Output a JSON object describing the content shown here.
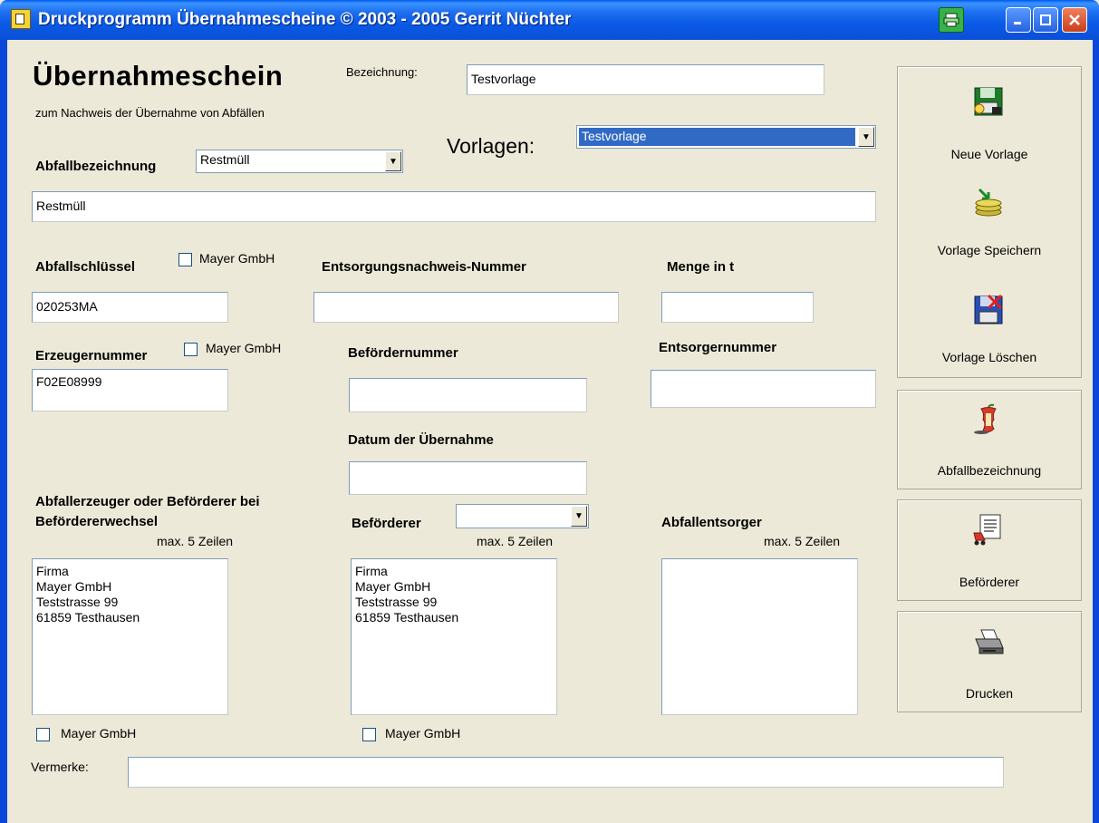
{
  "window": {
    "title": "Druckprogramm Übernahmescheine © 2003 - 2005 Gerrit Nüchter"
  },
  "header": {
    "title": "Übernahmeschein",
    "subtitle": "zum Nachweis der Übernahme von Abfällen",
    "bezeichnung_label": "Bezeichnung:",
    "bezeichnung_value": "Testvorlage",
    "vorlagen_label": "Vorlagen:",
    "vorlagen_value": "Testvorlage"
  },
  "abfall": {
    "label": "Abfallbezeichnung",
    "combo_value": "Restmüll",
    "text_value": "Restmüll"
  },
  "schluessel": {
    "label": "Abfallschlüssel",
    "checkbox_label": "Mayer GmbH",
    "value": "020253MA"
  },
  "entsorgungsnachweis": {
    "label": "Entsorgungsnachweis-Nummer",
    "value": ""
  },
  "menge": {
    "label": "Menge in t",
    "value": ""
  },
  "erzeuger": {
    "label": "Erzeugernummer",
    "checkbox_label": "Mayer GmbH",
    "value": "F02E08999"
  },
  "befoerdernummer": {
    "label": "Befördernummer",
    "value": ""
  },
  "entsorgernummer": {
    "label": "Entsorgernummer",
    "value": ""
  },
  "datum": {
    "label": "Datum der Übernahme",
    "value": ""
  },
  "erzeuger_block": {
    "label_line1": "Abfallerzeuger oder Beförderer bei",
    "label_line2": "Befördererwechsel",
    "hint": "max. 5 Zeilen",
    "lines": "Firma\nMayer GmbH\nTeststrasse 99\n61859 Testhausen",
    "checkbox_label": "Mayer GmbH"
  },
  "befoerderer_block": {
    "label": "Beförderer",
    "combo_value": "",
    "hint": "max. 5 Zeilen",
    "lines": "Firma\nMayer GmbH\nTeststrasse 99\n61859 Testhausen",
    "checkbox_label": "Mayer GmbH"
  },
  "entsorger_block": {
    "label": "Abfallentsorger",
    "hint": "max. 5 Zeilen",
    "lines": ""
  },
  "vermerke": {
    "label": "Vermerke:",
    "value": ""
  },
  "sidebar": {
    "neue_vorlage": "Neue Vorlage",
    "vorlage_speichern": "Vorlage Speichern",
    "vorlage_loeschen": "Vorlage Löschen",
    "abfallbezeichnung": "Abfallbezeichnung",
    "befoerderer": "Beförderer",
    "drucken": "Drucken"
  },
  "icons": {
    "app": "document-icon",
    "tray": "printer-tray-icon",
    "new_template": "floppy-disk-new-icon",
    "save_template": "disk-stack-save-icon",
    "delete_template": "floppy-disk-delete-icon",
    "waste": "apple-core-icon",
    "carrier": "document-cart-icon",
    "print": "printer-icon"
  },
  "colors": {
    "title_bar": "#0a4fd8",
    "face": "#ece9d8",
    "selection": "#316ac5"
  }
}
